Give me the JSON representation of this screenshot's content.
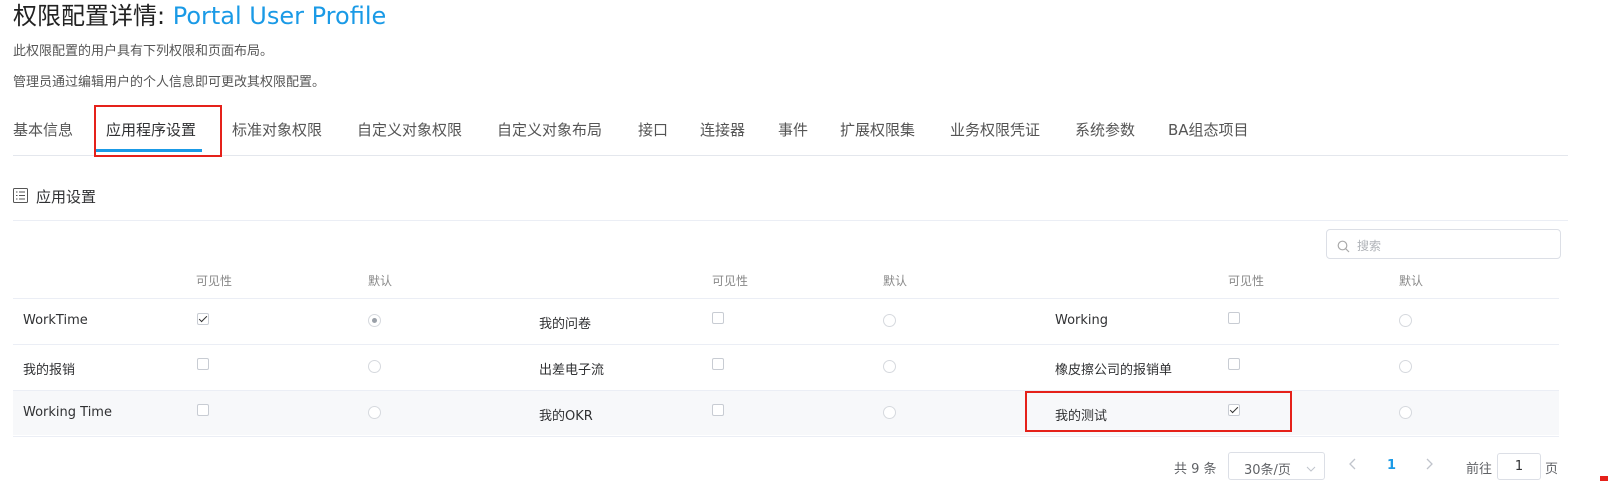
{
  "header": {
    "title_prefix": "权限配置详情: ",
    "title_name": "Portal User Profile",
    "description_1": "此权限配置的用户具有下列权限和页面布局。",
    "description_2": "管理员通过编辑用户的个人信息即可更改其权限配置。"
  },
  "tabs": [
    {
      "label": "基本信息"
    },
    {
      "label": "应用程序设置",
      "active": true
    },
    {
      "label": "标准对象权限"
    },
    {
      "label": "自定义对象权限"
    },
    {
      "label": "自定义对象布局"
    },
    {
      "label": "接口"
    },
    {
      "label": "连接器"
    },
    {
      "label": "事件"
    },
    {
      "label": "扩展权限集"
    },
    {
      "label": "业务权限凭证"
    },
    {
      "label": "系统参数"
    },
    {
      "label": "BA组态项目"
    }
  ],
  "section": {
    "icon": "list-icon",
    "title": "应用设置"
  },
  "search": {
    "placeholder": "搜索",
    "icon": "search-icon"
  },
  "table": {
    "headers": {
      "visibility": "可见性",
      "default": "默认"
    },
    "rows": [
      [
        {
          "name": "WorkTime",
          "visible": true,
          "default": true
        },
        {
          "name": "我的问卷",
          "visible": false,
          "default": false
        },
        {
          "name": "Working",
          "visible": false,
          "default": false
        }
      ],
      [
        {
          "name": "我的报销",
          "visible": false,
          "default": false
        },
        {
          "name": "出差电子流",
          "visible": false,
          "default": false
        },
        {
          "name": "橡皮擦公司的报销单",
          "visible": false,
          "default": false
        }
      ],
      [
        {
          "name": "Working Time",
          "visible": false,
          "default": false
        },
        {
          "name": "我的OKR",
          "visible": false,
          "default": false
        },
        {
          "name": "我的测试",
          "visible": true,
          "default": false
        }
      ]
    ]
  },
  "pagination": {
    "total_text": "共 9 条",
    "page_size": "30条/页",
    "current_page": "1",
    "goto_label": "前往",
    "goto_value": "1",
    "goto_suffix": "页"
  },
  "colors": {
    "accent": "#1a9ae6",
    "highlight_box": "#e5211a"
  }
}
